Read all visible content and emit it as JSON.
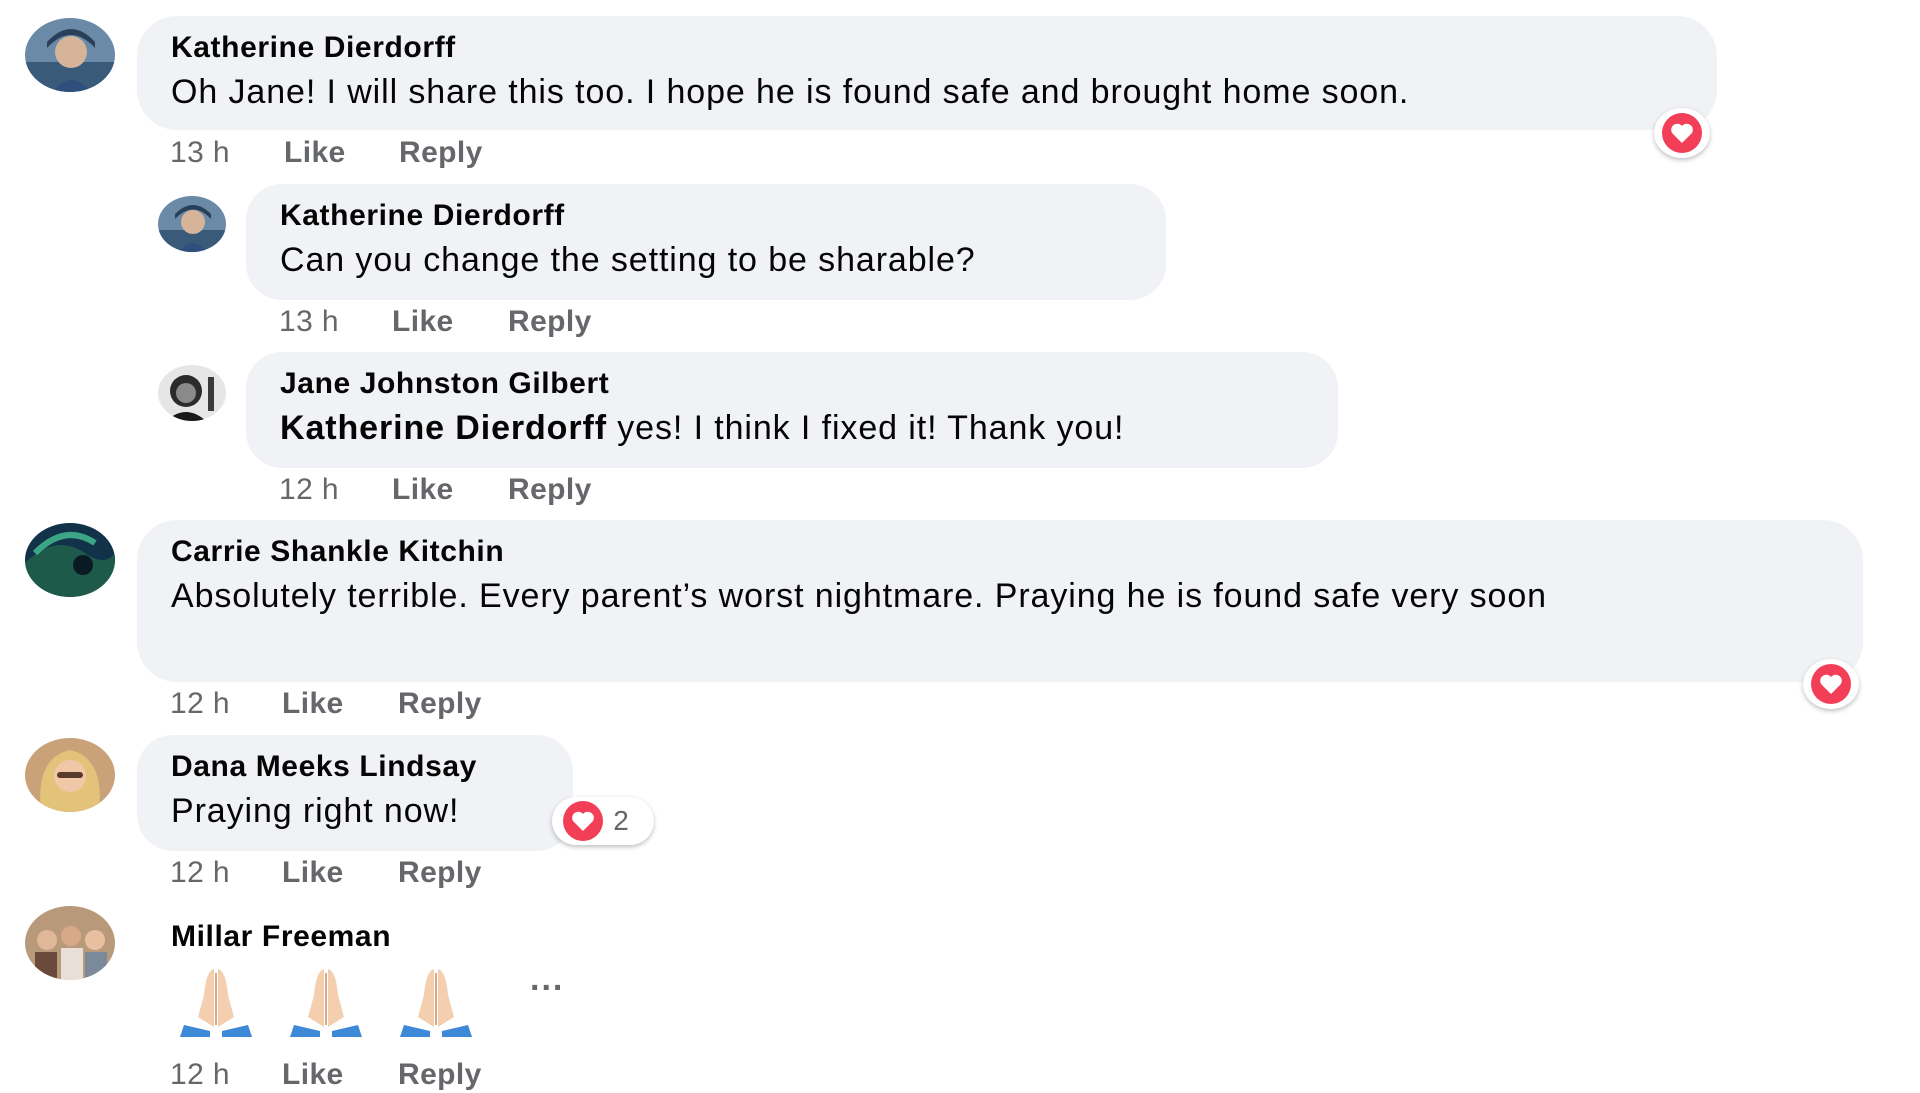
{
  "comments": [
    {
      "author": "Katherine Dierdorff",
      "text": "Oh Jane! I will share this too. I hope he is found safe and brought home soon.",
      "time": "13 h",
      "like": "Like",
      "reply": "Reply",
      "reaction": "heart-icon"
    },
    {
      "author": "Katherine Dierdorff",
      "text": "Can you change the setting to be sharable?",
      "time": "13 h",
      "like": "Like",
      "reply": "Reply"
    },
    {
      "author": "Jane Johnston Gilbert",
      "mention": "Katherine Dierdorff",
      "text": " yes! I think I fixed it! Thank you!",
      "time": "12 h",
      "like": "Like",
      "reply": "Reply"
    },
    {
      "author": "Carrie Shankle Kitchin",
      "text": "Absolutely terrible. Every parent’s worst nightmare. Praying he is found safe very soon",
      "time": "12 h",
      "like": "Like",
      "reply": "Reply",
      "reaction": "heart-icon"
    },
    {
      "author": "Dana Meeks Lindsay",
      "text": "Praying right now!",
      "time": "12 h",
      "like": "Like",
      "reply": "Reply",
      "reaction": "heart-icon",
      "reaction_count": "2"
    },
    {
      "author": "Millar Freeman",
      "emoji": [
        "🙏",
        "🙏",
        "🙏"
      ],
      "more": "...",
      "time": "12 h",
      "like": "Like",
      "reply": "Reply"
    }
  ],
  "colors": {
    "bubble": "#f0f2f5",
    "meta": "#65676b",
    "heart": "#f33e58"
  }
}
